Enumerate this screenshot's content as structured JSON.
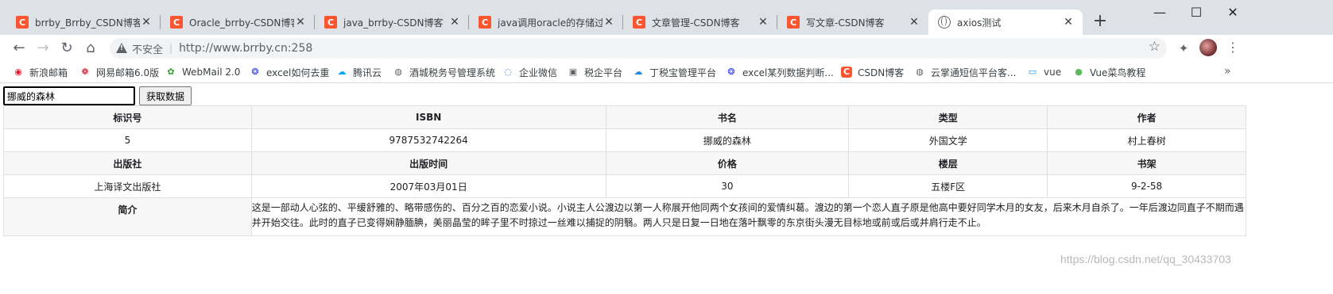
{
  "tabs": [
    {
      "title": "brrby_Brrby_CSDN博客-js",
      "icon": "csdn-icon"
    },
    {
      "title": "Oracle_brrby-CSDN博客",
      "icon": "csdn-icon"
    },
    {
      "title": "java_brrby-CSDN博客",
      "icon": "csdn-icon"
    },
    {
      "title": "java调用oracle的存储过程",
      "icon": "csdn-icon"
    },
    {
      "title": "文章管理-CSDN博客",
      "icon": "csdn-icon"
    },
    {
      "title": "写文章-CSDN博客",
      "icon": "csdn-icon"
    },
    {
      "title": "axios测试",
      "icon": "globe-icon",
      "active": true
    }
  ],
  "window": {
    "minimize": "—",
    "maximize": "☐",
    "close": "✕",
    "new_tab": "+"
  },
  "address": {
    "security_label": "不安全",
    "url": "http://www.brrby.cn:258"
  },
  "bookmarks": [
    {
      "label": "新浪邮箱",
      "icon": "weibo-icon",
      "color": "#e6162d"
    },
    {
      "label": "网易邮箱6.0版",
      "icon": "netease-icon",
      "color": "#d0021b"
    },
    {
      "label": "WebMail 2.0",
      "icon": "leaf-icon",
      "color": "#2e9e2e"
    },
    {
      "label": "excel如何去重",
      "icon": "baidu-paw-icon",
      "color": "#2932e1"
    },
    {
      "label": "腾讯云",
      "icon": "cloud-icon",
      "color": "#00a4ff"
    },
    {
      "label": "酒城税务号管理系统",
      "icon": "globe-icon",
      "color": "#5f6368"
    },
    {
      "label": "企业微信",
      "icon": "wecom-icon",
      "color": "#2c7be5"
    },
    {
      "label": "税企平台",
      "icon": "image-icon",
      "color": "#5f6368"
    },
    {
      "label": "丁税宝管理平台",
      "icon": "cloud-icon",
      "color": "#1e88e5"
    },
    {
      "label": "excel某列数据判断...",
      "icon": "baidu-paw-icon",
      "color": "#2932e1"
    },
    {
      "label": "CSDN博客",
      "icon": "csdn-icon",
      "color": "#fc5531"
    },
    {
      "label": "云掌通短信平台客...",
      "icon": "globe-icon",
      "color": "#5f6368"
    },
    {
      "label": "vue",
      "icon": "tv-icon",
      "color": "#1e88e5"
    },
    {
      "label": "Vue菜鸟教程",
      "icon": "runoob-icon",
      "color": "#5cb85c"
    }
  ],
  "form": {
    "input_value": "挪威的森林",
    "button_label": "获取数据"
  },
  "table": {
    "row1_headers": [
      "标识号",
      "ISBN",
      "书名",
      "类型",
      "作者"
    ],
    "row1_values": [
      "5",
      "9787532742264",
      "挪威的森林",
      "外国文学",
      "村上春树"
    ],
    "row2_headers": [
      "出版社",
      "出版时间",
      "价格",
      "楼层",
      "书架"
    ],
    "row2_values": [
      "上海译文出版社",
      "2007年03月01日",
      "30",
      "五楼F区",
      "9-2-58"
    ],
    "summary_label": "简介",
    "summary_text": "这是一部动人心弦的、平缓舒雅的、略带感伤的、百分之百的恋爱小说。小说主人公渡边以第一人称展开他同两个女孩间的爱情纠葛。渡边的第一个恋人直子原是他高中要好同学木月的女友，后来木月自杀了。一年后渡边同直子不期而遇并开始交往。此时的直子已变得娴静腼腆，美丽晶莹的眸子里不时掠过一丝难以捕捉的阴翳。两人只是日复一日地在落叶飘零的东京街头漫无目标地或前或后或并肩行走不止。"
  },
  "watermark": "https://blog.csdn.net/qq_30433703"
}
